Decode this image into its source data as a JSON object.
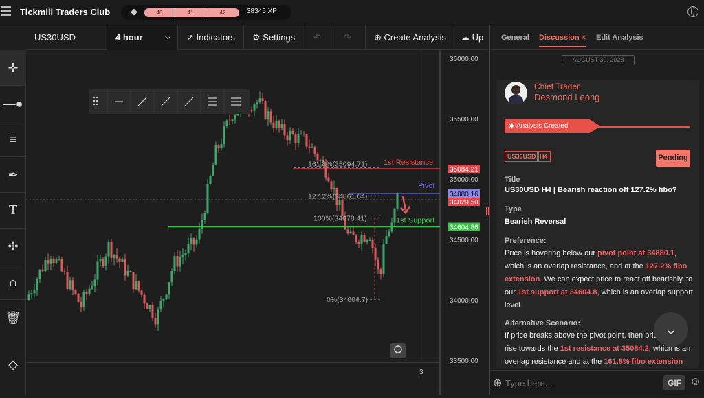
{
  "app": {
    "brand": "Tickmill Traders Club",
    "levels": [
      "40",
      "41",
      "42"
    ],
    "xp": "38345 XP"
  },
  "chart_toolbar": {
    "symbol": "US30USD",
    "timeframe": "4 hour",
    "indicators": "Indicators",
    "settings": "Settings",
    "create": "Create Analysis",
    "upload": "Up"
  },
  "chart": {
    "y_ticks": [
      "36000.00",
      "35500.00",
      "35000.00",
      "34500.00",
      "34000.00",
      "33500.00"
    ],
    "x_tick": "3",
    "price_tags": {
      "r1": "35084.21",
      "pivot": "34880.16",
      "current": "34829.50",
      "s1": "34604.86"
    },
    "labels": {
      "r1": "1st Resistance",
      "pivot": "Pivot",
      "s1": "1st Support",
      "fib1618": "161.8%(35094.71)",
      "fib1272": "127.2%(34861.64)",
      "fib100": "100%(34678.41)",
      "fib0": "0%(34004.7)"
    },
    "colors": {
      "resistance": "#e8474a",
      "pivot": "#6a6ad8",
      "support": "#3cc24a",
      "up": "#3fa86a",
      "down": "#e05a5a"
    }
  },
  "panel": {
    "tabs": {
      "general": "General",
      "discussion": "Discussion",
      "edit": "Edit Analysis"
    },
    "date": "AUGUST 30, 2023",
    "author_role": "Chief Trader",
    "author_name": "Desmond Leong",
    "badge": "Analysis Created",
    "tags": [
      "US30USD",
      "H4"
    ],
    "status": "Pending",
    "title_label": "Title",
    "title_value": "US30USD H4 | Bearish reaction off 127.2% fibo?",
    "type_label": "Type",
    "type_value": "Bearish Reversal",
    "pref_label": "Preference:",
    "pref_text": {
      "p1": "Price is hovering below our ",
      "h1": "pivot point at 34880.1",
      "p2": ", which is an overlap resistance, and at the ",
      "h2": "127.2% fibo extension",
      "p3": ". We can expect price to react off bearishly, to our ",
      "h3": "1st support at 34604.8",
      "p4": ", which is an overlap support level."
    },
    "alt_label": "Alternative Scenario:",
    "alt_text": {
      "p1": "If price breaks above the pivot point, then price could rise towards the ",
      "h1": "1st resistance at 35084.2",
      "p2": ", which is an overlap resistance and at the ",
      "h2": "161.8% fibo extension"
    },
    "compose_placeholder": "Type here...",
    "gif": "GIF"
  }
}
